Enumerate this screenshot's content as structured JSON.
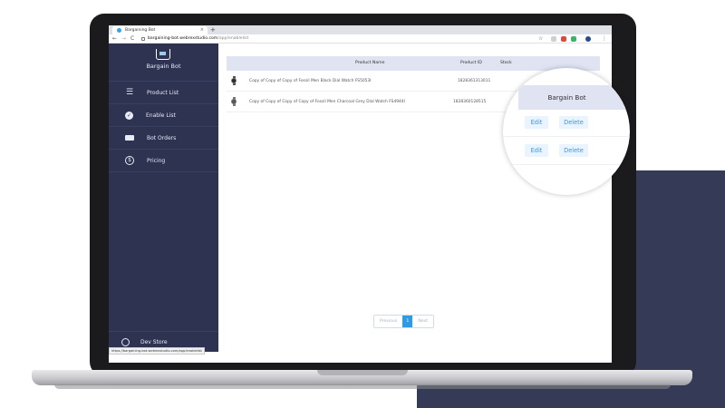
{
  "browser": {
    "tab_title": "Bargaining Bot",
    "tab_close": "×",
    "new_tab": "+",
    "url_host": "bargaining-bot.webrexstudio.com",
    "url_path": "/app/enablelist",
    "status_url": "https://bargaining-bot.webrexstudio.com/app/enablelist"
  },
  "sidebar": {
    "brand": "Bargain Bot",
    "items": [
      {
        "label": "Product List",
        "icon": "list-icon"
      },
      {
        "label": "Enable List",
        "icon": "check-circle-icon"
      },
      {
        "label": "Bot Orders",
        "icon": "truck-icon"
      },
      {
        "label": "Pricing",
        "icon": "dollar-icon"
      }
    ],
    "store": "Dev Store"
  },
  "table": {
    "headers": {
      "name": "Product Name",
      "id": "Product ID",
      "stock": "Stock"
    },
    "rows": [
      {
        "name": "Copy of Copy of Copy of Fossil Men Black Dial Watch FS5053I",
        "id": "1828361313011",
        "stock": ""
      },
      {
        "name": "Copy of Copy of Copy of Copy of Fossil Men Charcoal Grey Dial Watch FS4944I",
        "id": "1828360128515",
        "stock": ""
      }
    ]
  },
  "pagination": {
    "previous": "Previous",
    "page": "1",
    "next": "Next"
  },
  "lens": {
    "header": "Bargain Bot",
    "edit_label": "Edit",
    "delete_label": "Delete"
  },
  "colors": {
    "sidebar_bg": "#2e3352",
    "table_header_bg": "#dfe3f2",
    "accent": "#2f9be4",
    "navy_block": "#353a56"
  }
}
